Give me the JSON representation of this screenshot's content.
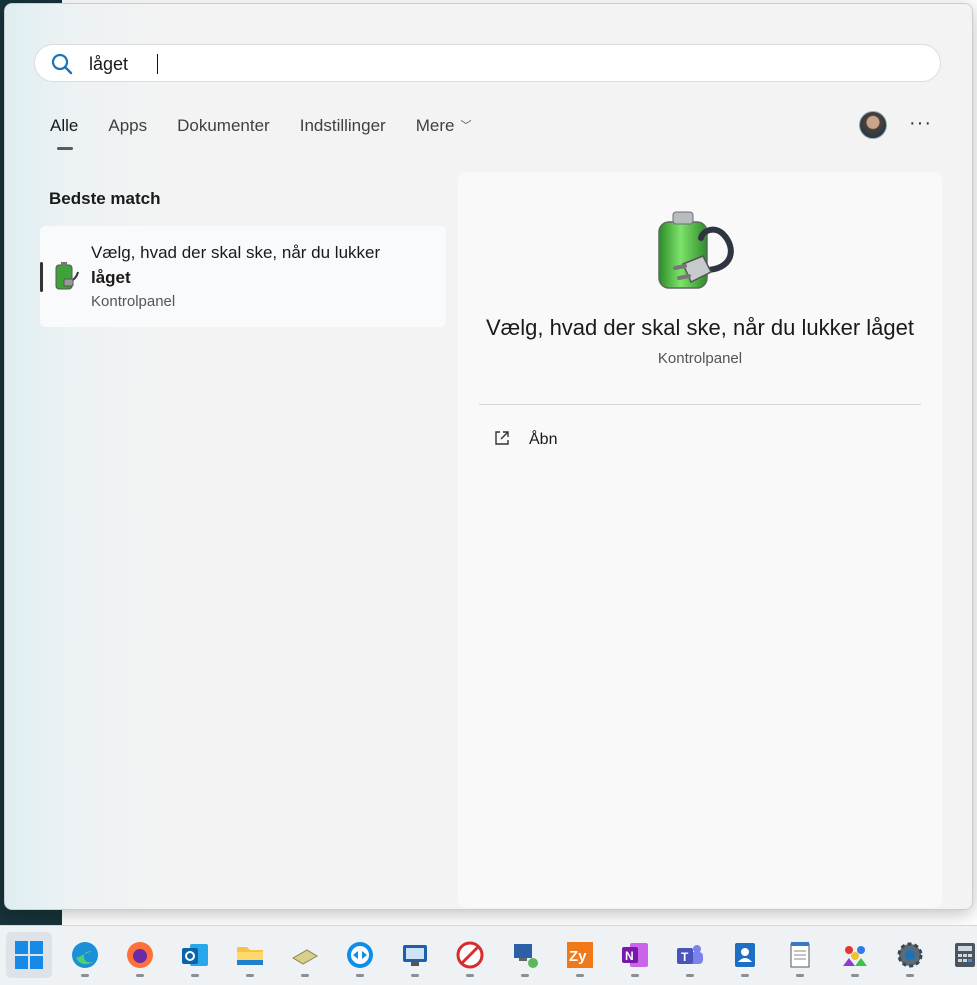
{
  "search": {
    "value": "låget",
    "icon": "search-icon"
  },
  "tabs": [
    {
      "label": "Alle",
      "active": true
    },
    {
      "label": "Apps",
      "active": false
    },
    {
      "label": "Dokumenter",
      "active": false
    },
    {
      "label": "Indstillinger",
      "active": false
    },
    {
      "label": "Mere",
      "active": false,
      "dropdown": true
    }
  ],
  "header": {
    "more_label": "···"
  },
  "best_match": {
    "section_title": "Bedste match",
    "item": {
      "title_prefix": "Vælg, hvad der skal ske, når du lukker ",
      "title_bold": "låget",
      "subtitle": "Kontrolpanel",
      "icon": "battery-plug-icon"
    }
  },
  "detail": {
    "title": "Vælg, hvad der skal ske, når du lukker låget",
    "subtitle": "Kontrolpanel",
    "actions": [
      {
        "label": "Åbn",
        "icon": "open-external-icon"
      }
    ]
  },
  "taskbar": {
    "items": [
      {
        "name": "start-button",
        "icon": "windows-logo-icon"
      },
      {
        "name": "edge",
        "icon": "edge-icon",
        "running": true
      },
      {
        "name": "firefox",
        "icon": "firefox-icon",
        "running": true
      },
      {
        "name": "outlook",
        "icon": "outlook-icon",
        "running": true
      },
      {
        "name": "file-explorer",
        "icon": "folder-icon",
        "running": true
      },
      {
        "name": "app-money",
        "icon": "money-icon",
        "running": true
      },
      {
        "name": "teamviewer",
        "icon": "teamviewer-icon",
        "running": true
      },
      {
        "name": "remote-desktop",
        "icon": "remote-desktop-icon",
        "running": true
      },
      {
        "name": "app-blocker",
        "icon": "block-icon",
        "running": true
      },
      {
        "name": "network-computer",
        "icon": "network-computer-icon",
        "running": true
      },
      {
        "name": "zy-app",
        "icon": "zy-icon",
        "running": true
      },
      {
        "name": "onenote",
        "icon": "onenote-icon",
        "running": true
      },
      {
        "name": "teams",
        "icon": "teams-icon",
        "running": true
      },
      {
        "name": "contacts",
        "icon": "contacts-icon",
        "running": true
      },
      {
        "name": "notepad",
        "icon": "notepad-icon",
        "running": true
      },
      {
        "name": "app-people",
        "icon": "people-icon",
        "running": true
      },
      {
        "name": "settings",
        "icon": "gear-icon",
        "running": true
      },
      {
        "name": "calculator",
        "icon": "calculator-icon",
        "running": true
      }
    ]
  }
}
